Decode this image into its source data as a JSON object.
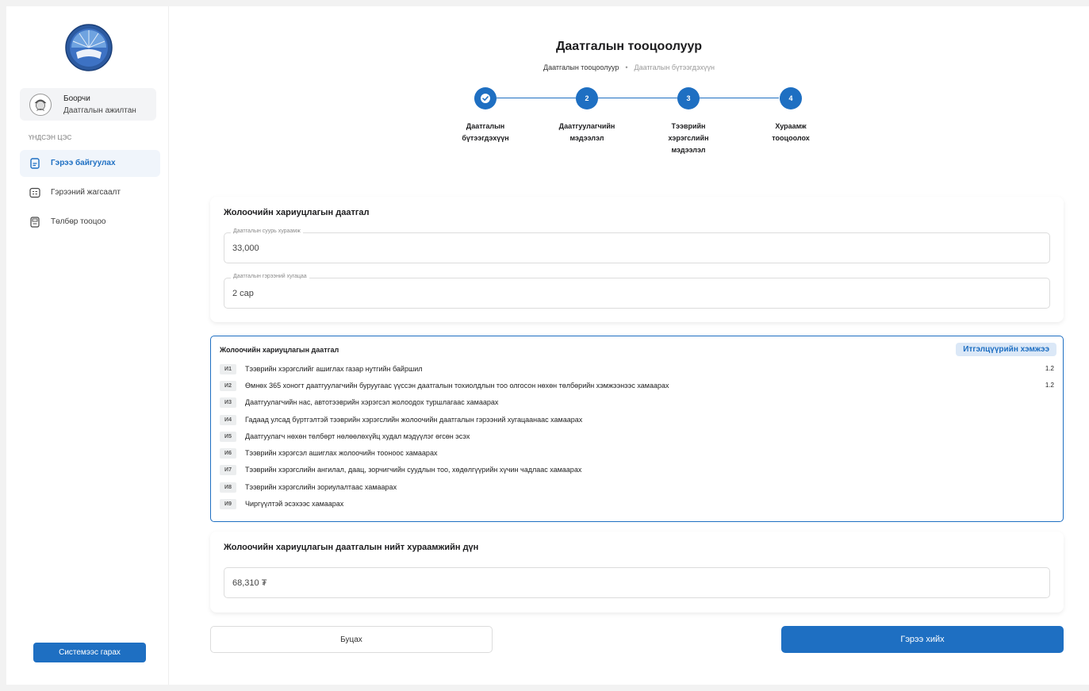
{
  "user": {
    "name": "Боорчи",
    "role": "Даатгалын ажилтан"
  },
  "sidebar": {
    "section_label": "ҮНДСЭН ЦЭС",
    "items": [
      {
        "label": "Гэрээ байгуулах",
        "icon": "document-icon",
        "active": true
      },
      {
        "label": "Гэрээний жагсаалт",
        "icon": "list-icon",
        "active": false
      },
      {
        "label": "Төлбөр тооцоо",
        "icon": "calculator-icon",
        "active": false
      }
    ],
    "logout_label": "Системээс гарах"
  },
  "header": {
    "title": "Даатгалын тооцоолуур",
    "breadcrumb": [
      "Даатгалын тооцоолуур",
      "Даатгалын бүтээгдэхүүн"
    ]
  },
  "stepper": {
    "steps": [
      {
        "number": "",
        "label": "Даатгалын\nбүтээгдэхүүн",
        "completed": true
      },
      {
        "number": "2",
        "label": "Даатгуулагчийн\nмэдээлэл",
        "completed": false
      },
      {
        "number": "3",
        "label": "Тээврийн\nхэрэгслийн\nмэдээлэл",
        "completed": false
      },
      {
        "number": "4",
        "label": "Хураамж\nтооцоолох",
        "completed": false
      }
    ]
  },
  "base_card": {
    "title": "Жолоочийн хариуцлагын даатгал",
    "base_premium_label": "Даатгалын суурь хураамж",
    "base_premium_value": "33,000",
    "term_label": "Даатгалын гэрээний хугацаа",
    "term_value": "2 сар"
  },
  "factors": {
    "title": "Жолоочийн хариуцлагын даатгал",
    "coefficient_label": "Итгэлцүүрийн хэмжээ",
    "rows": [
      {
        "code": "И1",
        "text": "Тээврийн хэрэгслийг ашиглах газар нутгийн байршил",
        "value": "1.2"
      },
      {
        "code": "И2",
        "text": "Өмнөх 365 хоногт даатгуулагчийн буруугаас үүссэн даатгалын тохиолдлын тоо олгосон нөхөн төлбөрийн хэмжээнээс хамаарах",
        "value": "1.2"
      },
      {
        "code": "И3",
        "text": "Даатгуулагчийн нас, автотээврийн хэрэгсэл жолоодох туршлагаас хамаарах",
        "value": ""
      },
      {
        "code": "И4",
        "text": "Гадаад улсад бүртгэлтэй тээврийн хэрэгслийн жолоочийн даатгалын гэрээний хугацаанаас хамаарах",
        "value": ""
      },
      {
        "code": "И5",
        "text": "Даатгуулагч нөхөн төлбөрт нөлөөлөхүйц худал мэдүүлэг өгсөн эсэх",
        "value": ""
      },
      {
        "code": "И6",
        "text": "Тээврийн хэрэгсэл ашиглах жолоочийн тооноос хамаарах",
        "value": ""
      },
      {
        "code": "И7",
        "text": "Тээврийн хэрэгслийн ангилал, даац, зорчигчийн суудлын тоо, хөдөлгүүрийн хүчин чадлаас хамаарах",
        "value": ""
      },
      {
        "code": "И8",
        "text": "Тээврийн хэрэгслийн зориулалтаас хамаарах",
        "value": ""
      },
      {
        "code": "И9",
        "text": "Чиргүүлтэй эсэхээс хамаарах",
        "value": ""
      }
    ]
  },
  "total_card": {
    "title": "Жолоочийн хариуцлагын даатгалын нийт хураамжийн дүн",
    "value": "68,310 ₮"
  },
  "actions": {
    "back_label": "Буцах",
    "submit_label": "Гэрээ хийх"
  },
  "colors": {
    "accent": "#1e6fc2",
    "badge_bg": "#dbe8f7"
  }
}
